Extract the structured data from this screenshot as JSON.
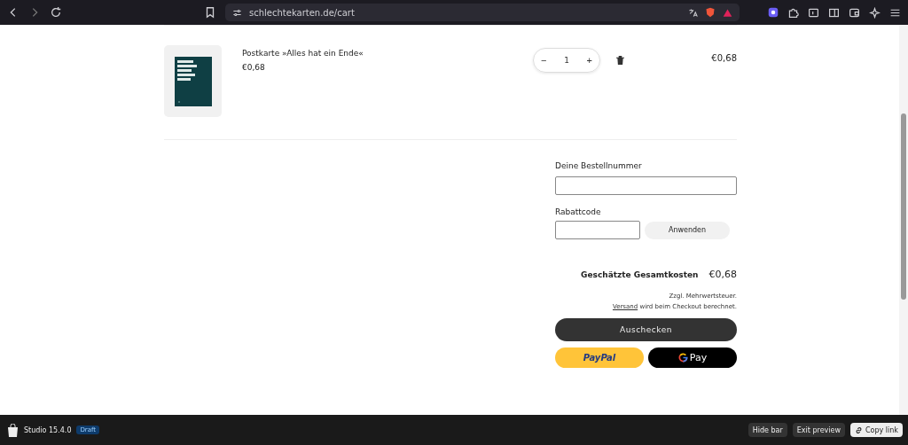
{
  "browser": {
    "url": "schlechtekarten.de/cart"
  },
  "cart_items": [
    {
      "title": "Postkarte »Alles hat ein Ende«",
      "unit_price": "€0,68",
      "quantity": "1",
      "decrease": "−",
      "increase": "+",
      "line_total": "€0,68"
    }
  ],
  "order_number": {
    "label": "Deine Bestellnummer"
  },
  "discount": {
    "label": "Rabattcode",
    "button": "Anwenden"
  },
  "total": {
    "label": "Geschätzte Gesamtkosten",
    "value": "€0,68"
  },
  "tax_note": "Zzgl. Mehrwertsteuer.",
  "shipping_note": {
    "link": "Versand",
    "text": "wird beim Checkout berechnet."
  },
  "checkout_button": "Auschecken",
  "paypal_button": "PayPal",
  "gpay_button": "Pay",
  "preview_bar": {
    "version": "Studio 15.4.0",
    "badge": "Draft",
    "buttons": [
      {
        "label": "Hide bar",
        "kind": "plain"
      },
      {
        "label": "Exit preview",
        "kind": "plain"
      },
      {
        "label": "Copy link",
        "kind": "link"
      }
    ]
  }
}
